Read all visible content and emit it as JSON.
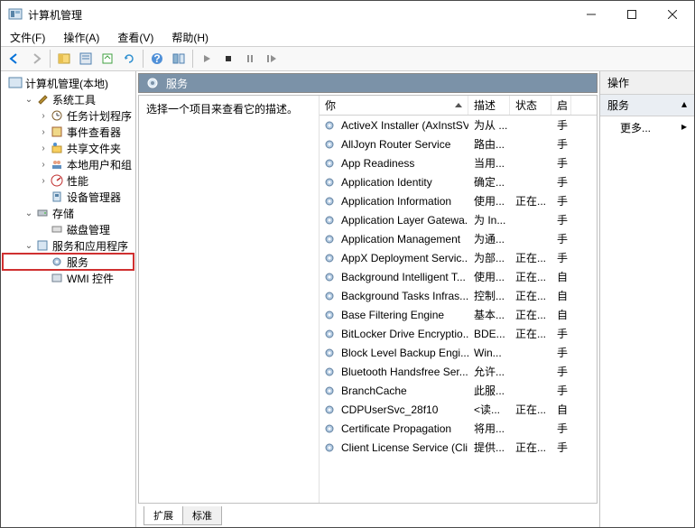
{
  "window": {
    "title": "计算机管理"
  },
  "menu": {
    "file": "文件(F)",
    "action": "操作(A)",
    "view": "查看(V)",
    "help": "帮助(H)"
  },
  "tree": {
    "root": "计算机管理(本地)",
    "system_tools": "系统工具",
    "task_scheduler": "任务计划程序",
    "event_viewer": "事件查看器",
    "shared_folders": "共享文件夹",
    "local_users": "本地用户和组",
    "performance": "性能",
    "device_manager": "设备管理器",
    "storage": "存储",
    "disk_mgmt": "磁盘管理",
    "services_apps": "服务和应用程序",
    "services": "服务",
    "wmi": "WMI 控件"
  },
  "services_panel": {
    "header": "服务",
    "prompt": "选择一个项目来查看它的描述。",
    "columns": {
      "name": "你",
      "desc": "描述",
      "state": "状态",
      "start": "启"
    },
    "rows": [
      {
        "name": "ActiveX Installer (AxInstSV)",
        "desc": "为从 ...",
        "state": "",
        "start": "手"
      },
      {
        "name": "AllJoyn Router Service",
        "desc": "路由...",
        "state": "",
        "start": "手"
      },
      {
        "name": "App Readiness",
        "desc": "当用...",
        "state": "",
        "start": "手"
      },
      {
        "name": "Application Identity",
        "desc": "确定...",
        "state": "",
        "start": "手"
      },
      {
        "name": "Application Information",
        "desc": "使用...",
        "state": "正在...",
        "start": "手"
      },
      {
        "name": "Application Layer Gatewa...",
        "desc": "为 In...",
        "state": "",
        "start": "手"
      },
      {
        "name": "Application Management",
        "desc": "为通...",
        "state": "",
        "start": "手"
      },
      {
        "name": "AppX Deployment Servic...",
        "desc": "为部...",
        "state": "正在...",
        "start": "手"
      },
      {
        "name": "Background Intelligent T...",
        "desc": "使用...",
        "state": "正在...",
        "start": "自"
      },
      {
        "name": "Background Tasks Infras...",
        "desc": "控制...",
        "state": "正在...",
        "start": "自"
      },
      {
        "name": "Base Filtering Engine",
        "desc": "基本...",
        "state": "正在...",
        "start": "自"
      },
      {
        "name": "BitLocker Drive Encryptio...",
        "desc": "BDE...",
        "state": "正在...",
        "start": "手"
      },
      {
        "name": "Block Level Backup Engi...",
        "desc": "Win...",
        "state": "",
        "start": "手"
      },
      {
        "name": "Bluetooth Handsfree Ser...",
        "desc": "允许...",
        "state": "",
        "start": "手"
      },
      {
        "name": "BranchCache",
        "desc": "此服...",
        "state": "",
        "start": "手"
      },
      {
        "name": "CDPUserSvc_28f10",
        "desc": "<读...",
        "state": "正在...",
        "start": "自"
      },
      {
        "name": "Certificate Propagation",
        "desc": "将用...",
        "state": "",
        "start": "手"
      },
      {
        "name": "Client License Service (Cli...",
        "desc": "提供...",
        "state": "正在...",
        "start": "手"
      }
    ]
  },
  "tabs": {
    "extended": "扩展",
    "standard": "标准"
  },
  "actions": {
    "header": "操作",
    "section": "服务",
    "more": "更多..."
  }
}
